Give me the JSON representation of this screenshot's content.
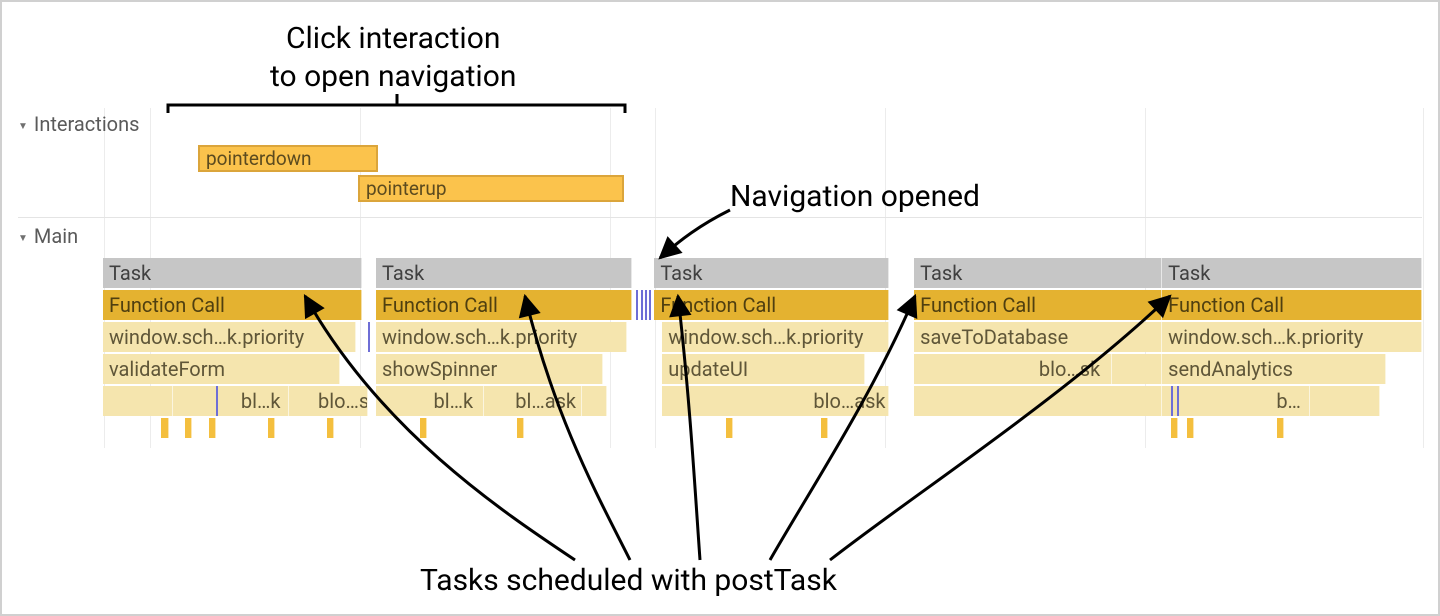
{
  "annotations": {
    "top": "Click interaction\nto open navigation",
    "right": "Navigation opened",
    "bottom": "Tasks scheduled with postTask"
  },
  "tracks": {
    "interactions": "Interactions",
    "main": "Main"
  },
  "interactions": {
    "pointerdown": "pointerdown",
    "pointerup": "pointerup"
  },
  "columns": [
    {
      "task": "Task",
      "func": "Function Call",
      "row3": "window.sch…k.priority",
      "row4": "validateForm",
      "row5a": "bl…k",
      "row5b": "blo…sk"
    },
    {
      "task": "Task",
      "func": "Function Call",
      "row3": "window.sch…k.priority",
      "row4": "showSpinner",
      "row5a": "bl…k",
      "row5b": "bl…ask"
    },
    {
      "task": "Task",
      "func": "Function Call",
      "row3": "window.sch…k.priority",
      "row4": "updateUI",
      "row5b": "blo…ask"
    },
    {
      "task": "Task",
      "func": "Function Call",
      "row3": "saveToDatabase",
      "row5a": "blo…sk"
    },
    {
      "task": "Task",
      "func": "Function Call",
      "row3": "window.sch…k.priority",
      "row4": "sendAnalytics",
      "row5a": "b…"
    }
  ]
}
